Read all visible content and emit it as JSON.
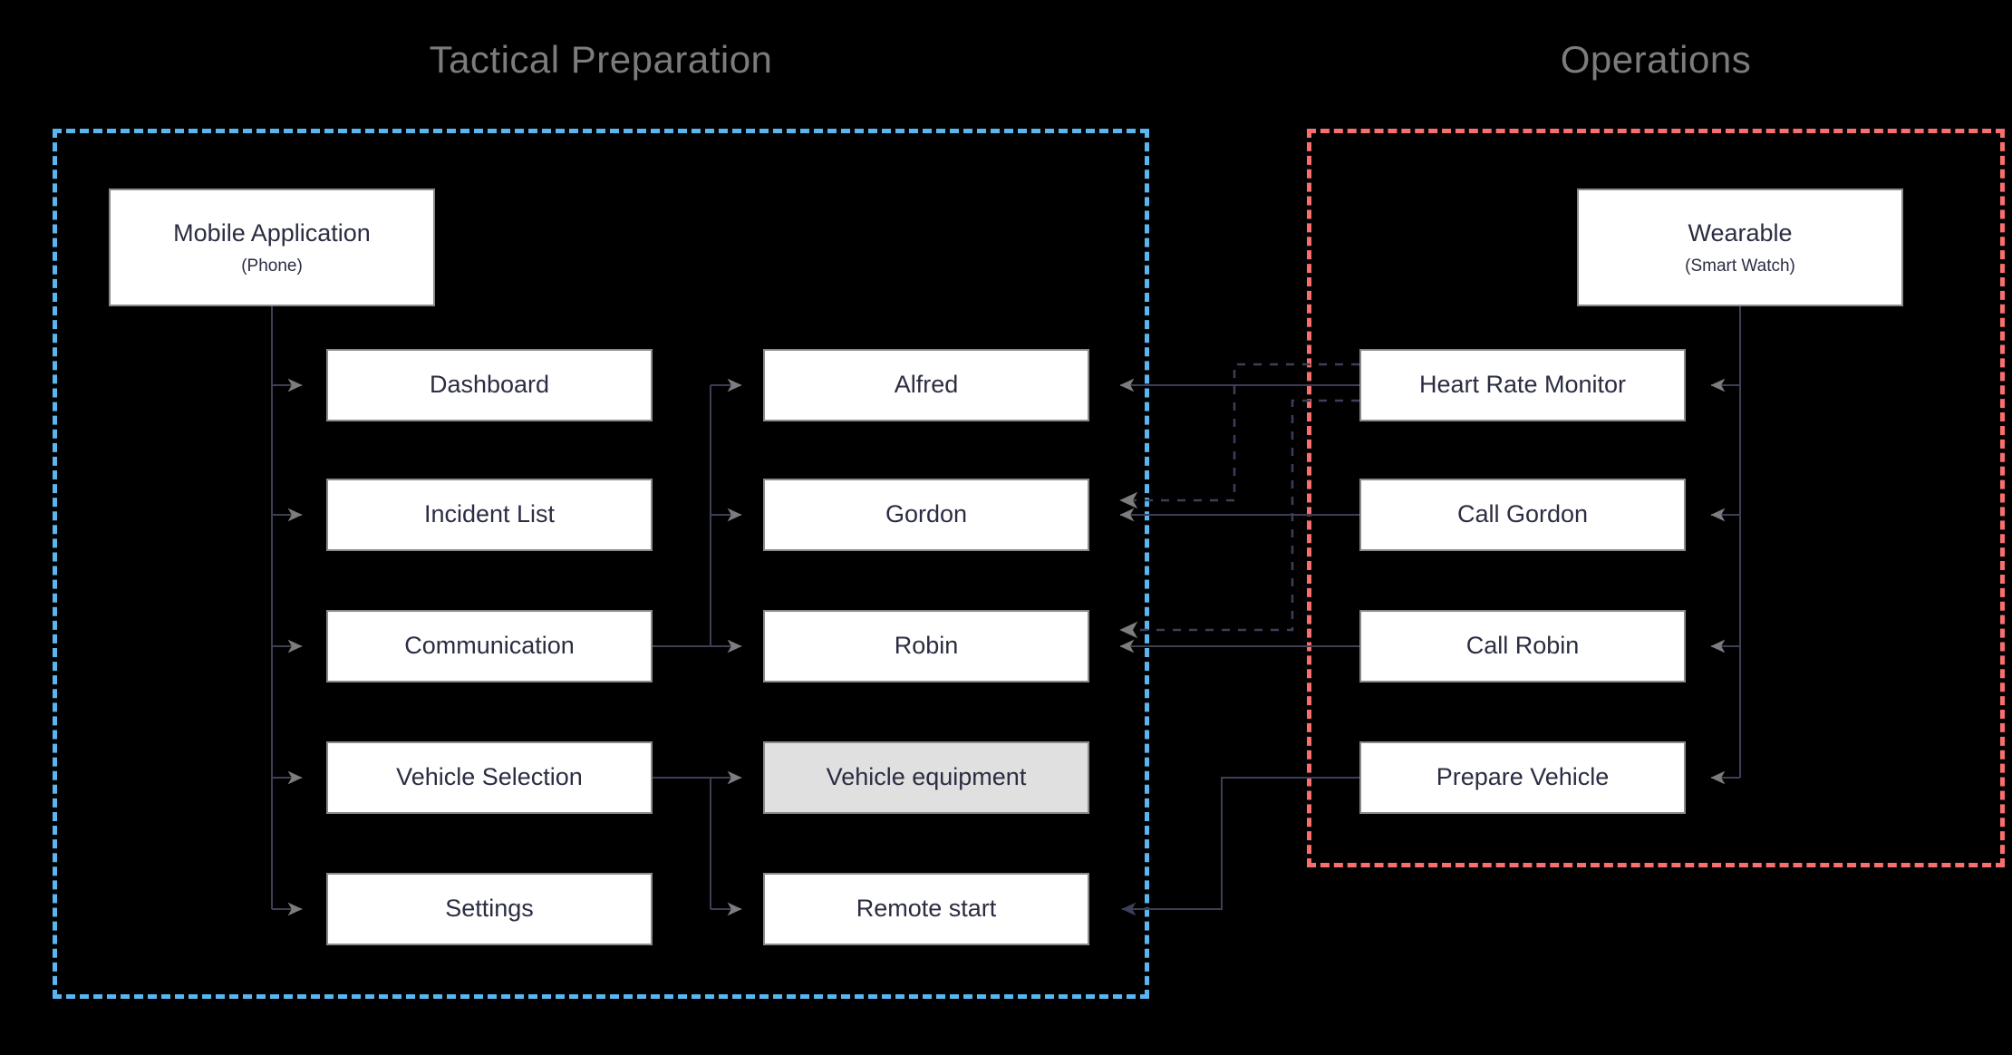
{
  "zones": [
    {
      "id": "tactical-preparation",
      "title": "Tactical Preparation",
      "color": "#5ab6ef"
    },
    {
      "id": "operations",
      "title": "Operations",
      "color": "#f76f6f"
    }
  ],
  "nodes": {
    "mobile_application": {
      "title": "Mobile Application",
      "subtitle": "(Phone)"
    },
    "wearable": {
      "title": "Wearable",
      "subtitle": "(Smart Watch)"
    },
    "dashboard": {
      "title": "Dashboard"
    },
    "incident_list": {
      "title": "Incident List"
    },
    "communication": {
      "title": "Communication"
    },
    "vehicle_selection": {
      "title": "Vehicle Selection"
    },
    "settings": {
      "title": "Settings"
    },
    "alfred": {
      "title": "Alfred"
    },
    "gordon": {
      "title": "Gordon"
    },
    "robin": {
      "title": "Robin"
    },
    "vehicle_equipment": {
      "title": "Vehicle equipment"
    },
    "remote_start": {
      "title": "Remote start"
    },
    "heart_rate_monitor": {
      "title": "Heart Rate Monitor"
    },
    "call_gordon": {
      "title": "Call Gordon"
    },
    "call_robin": {
      "title": "Call Robin"
    },
    "prepare_vehicle": {
      "title": "Prepare Vehicle"
    }
  },
  "colors": {
    "background": "#000000",
    "node_fill": "#ffffff",
    "node_fill_shaded": "#e0e0e0",
    "node_border": "#8a8a8a",
    "node_text": "#2b2d42",
    "zone_title": "#7c7c7c",
    "zone_prep_border": "#5ab6ef",
    "zone_ops_border": "#f76f6f",
    "wire": "#3d3f57",
    "arrow_gray": "#7d7d7d",
    "arrow_dark": "#3d3f57"
  }
}
